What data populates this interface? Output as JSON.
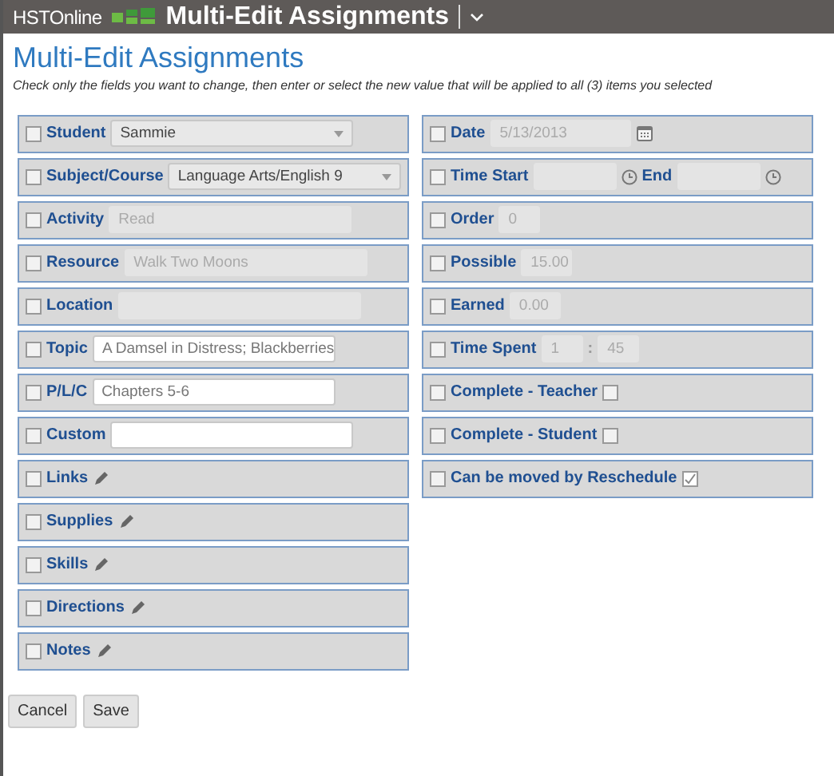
{
  "header": {
    "brand": "HSTOnline",
    "title": "Multi-Edit Assignments"
  },
  "page": {
    "heading": "Multi-Edit Assignments",
    "instructions": "Check only the fields you want to change, then enter or select the new value that will be applied to all (3) items you selected"
  },
  "left_fields": [
    {
      "kind": "select",
      "label": "Student",
      "checked": false,
      "value": "Sammie"
    },
    {
      "kind": "select",
      "label": "Subject/Course",
      "checked": false,
      "value": "Language Arts/English 9"
    },
    {
      "kind": "text",
      "label": "Activity",
      "checked": false,
      "placeholder": "Read",
      "disabled": true
    },
    {
      "kind": "text",
      "label": "Resource",
      "checked": false,
      "placeholder": "Walk Two Moons",
      "disabled": true
    },
    {
      "kind": "text",
      "label": "Location",
      "checked": false,
      "disabled": true
    },
    {
      "kind": "text",
      "label": "Topic",
      "checked": false,
      "placeholder": "A Damsel in Distress; Blackberries",
      "disabled": false
    },
    {
      "kind": "text",
      "label": "P/L/C",
      "checked": false,
      "placeholder": "Chapters 5-6",
      "disabled": false
    },
    {
      "kind": "text",
      "label": "Custom",
      "checked": false,
      "disabled": false
    },
    {
      "kind": "pencil",
      "label": "Links",
      "checked": false
    },
    {
      "kind": "pencil",
      "label": "Supplies",
      "checked": false
    },
    {
      "kind": "pencil",
      "label": "Skills",
      "checked": false
    },
    {
      "kind": "pencil",
      "label": "Directions",
      "checked": false
    },
    {
      "kind": "pencil",
      "label": "Notes",
      "checked": false
    }
  ],
  "right_fields": [
    {
      "kind": "date",
      "label": "Date",
      "checked": false,
      "placeholder": "5/13/2013",
      "disabled": true
    },
    {
      "kind": "time_range",
      "label": "Time Start",
      "checked": false,
      "end_label": "End",
      "disabled": true
    },
    {
      "kind": "small",
      "label": "Order",
      "checked": false,
      "placeholder": "0",
      "disabled": true
    },
    {
      "kind": "small",
      "label": "Possible",
      "checked": false,
      "placeholder": "15.00",
      "disabled": true
    },
    {
      "kind": "small",
      "label": "Earned",
      "checked": false,
      "placeholder": "0.00",
      "disabled": true
    },
    {
      "kind": "duration",
      "label": "Time Spent",
      "checked": false,
      "hours": "1",
      "separator": ":",
      "minutes": "45",
      "disabled": true
    },
    {
      "kind": "flag",
      "label": "Complete - Teacher",
      "checked": false,
      "value_checked": false
    },
    {
      "kind": "flag",
      "label": "Complete - Student",
      "checked": false,
      "value_checked": false
    },
    {
      "kind": "flag",
      "label": "Can be moved by Reschedule",
      "checked": false,
      "value_checked": true
    }
  ],
  "buttons": [
    {
      "label": "Cancel"
    },
    {
      "label": "Save"
    }
  ]
}
